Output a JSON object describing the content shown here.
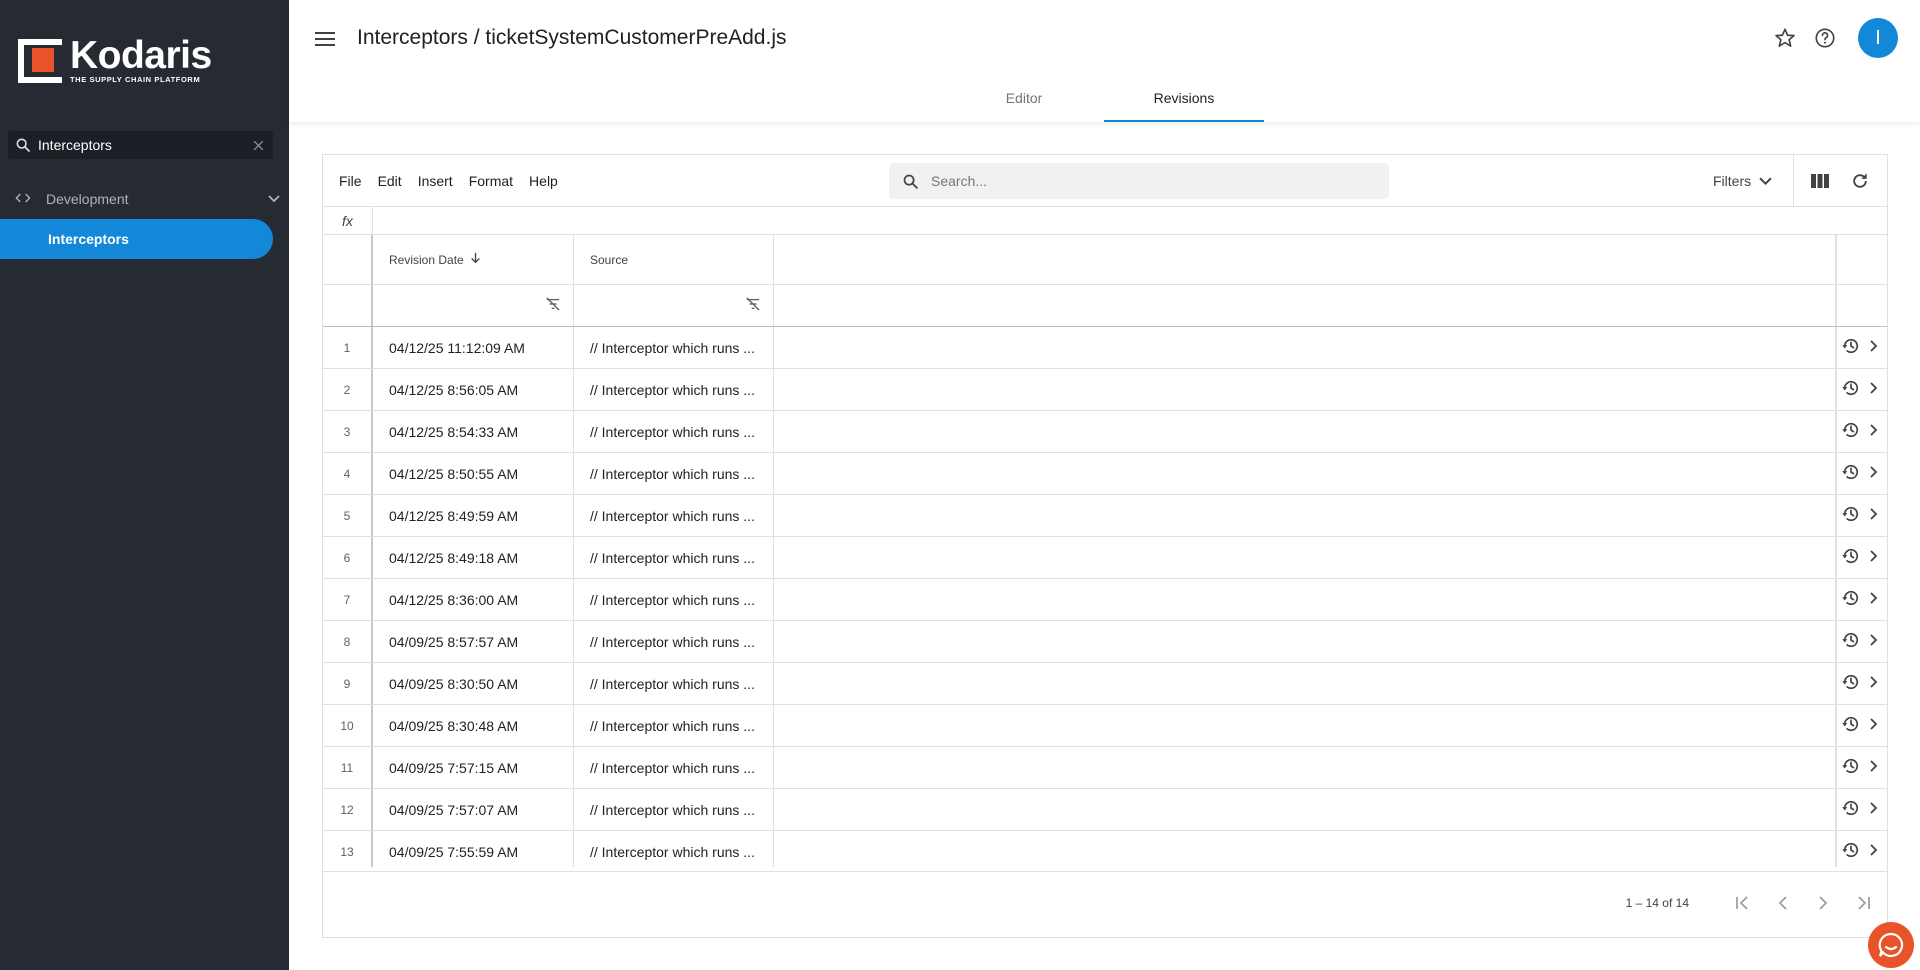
{
  "sidebar": {
    "logo_name": "Kodaris",
    "logo_tagline": "THE SUPPLY CHAIN PLATFORM",
    "search_value": "Interceptors",
    "nav_group_label": "Development",
    "nav_item_label": "Interceptors"
  },
  "header": {
    "title": "Interceptors / ticketSystemCustomerPreAdd.js",
    "avatar_letter": "I",
    "tabs": [
      {
        "label": "Editor",
        "active": false
      },
      {
        "label": "Revisions",
        "active": true
      }
    ]
  },
  "toolbar": {
    "menus": [
      "File",
      "Edit",
      "Insert",
      "Format",
      "Help"
    ],
    "search_placeholder": "Search...",
    "filters_label": "Filters"
  },
  "fx_label": "fx",
  "columns": {
    "revision_date": "Revision Date",
    "source": "Source"
  },
  "rows": [
    {
      "n": "1",
      "date": "04/12/25 11:12:09 AM",
      "source": "// Interceptor which runs ..."
    },
    {
      "n": "2",
      "date": "04/12/25 8:56:05 AM",
      "source": "// Interceptor which runs ..."
    },
    {
      "n": "3",
      "date": "04/12/25 8:54:33 AM",
      "source": "// Interceptor which runs ..."
    },
    {
      "n": "4",
      "date": "04/12/25 8:50:55 AM",
      "source": "// Interceptor which runs ..."
    },
    {
      "n": "5",
      "date": "04/12/25 8:49:59 AM",
      "source": "// Interceptor which runs ..."
    },
    {
      "n": "6",
      "date": "04/12/25 8:49:18 AM",
      "source": "// Interceptor which runs ..."
    },
    {
      "n": "7",
      "date": "04/12/25 8:36:00 AM",
      "source": "// Interceptor which runs ..."
    },
    {
      "n": "8",
      "date": "04/09/25 8:57:57 AM",
      "source": "// Interceptor which runs ..."
    },
    {
      "n": "9",
      "date": "04/09/25 8:30:50 AM",
      "source": "// Interceptor which runs ..."
    },
    {
      "n": "10",
      "date": "04/09/25 8:30:48 AM",
      "source": "// Interceptor which runs ..."
    },
    {
      "n": "11",
      "date": "04/09/25 7:57:15 AM",
      "source": "// Interceptor which runs ..."
    },
    {
      "n": "12",
      "date": "04/09/25 7:57:07 AM",
      "source": "// Interceptor which runs ..."
    },
    {
      "n": "13",
      "date": "04/09/25 7:55:59 AM",
      "source": "// Interceptor which runs ..."
    }
  ],
  "pagination": {
    "text": "1 – 14 of 14"
  },
  "colors": {
    "accent": "#1488d8",
    "brand_orange": "#e8532a",
    "sidebar_bg": "#262b33"
  },
  "icons": {
    "menu": "hamburger-icon",
    "favorite": "star-icon",
    "help": "help-icon",
    "columns": "columns-icon",
    "refresh": "refresh-icon",
    "row_history": "history-icon",
    "row_open": "chevron-right-icon",
    "chat": "chat-icon"
  }
}
